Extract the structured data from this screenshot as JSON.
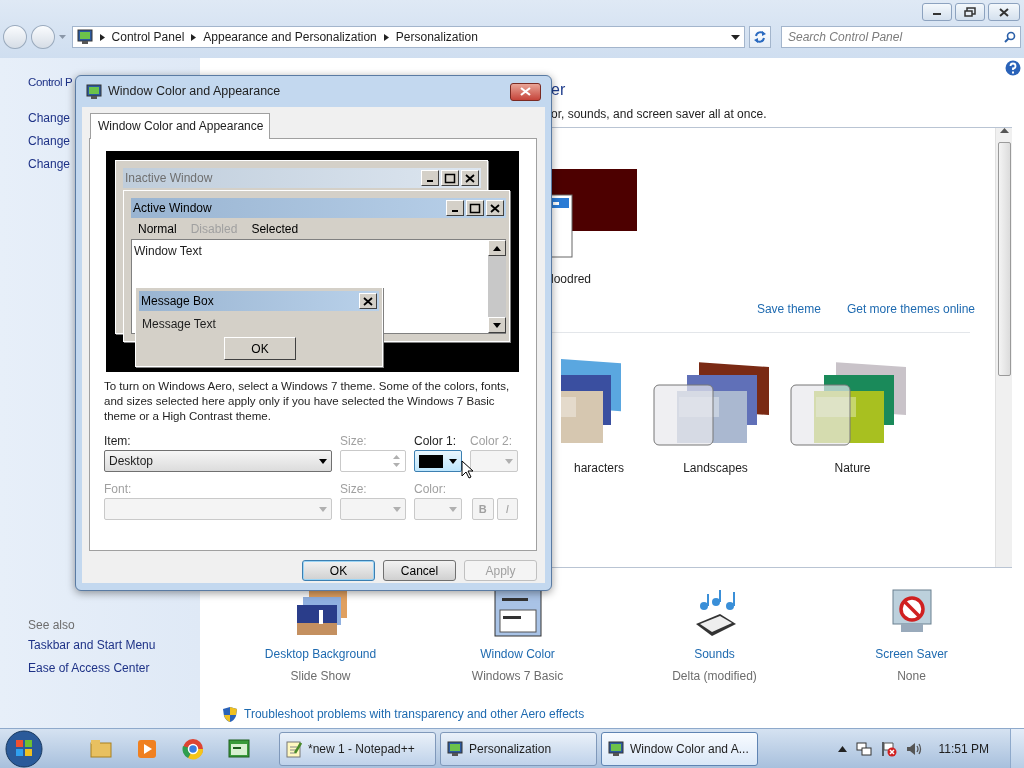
{
  "explorer": {
    "breadcrumb": [
      "Control Panel",
      "Appearance and Personalization",
      "Personalization"
    ],
    "search": {
      "placeholder": "Search Control Panel"
    }
  },
  "sidebar": {
    "items": [
      "Control P",
      "Change",
      "Change",
      "Change"
    ],
    "see_also": {
      "heading": "See also",
      "links": [
        "Taskbar and Start Menu",
        "Ease of Access Center"
      ]
    }
  },
  "main": {
    "heading": "er",
    "description": "or, sounds, and screen saver all at once.",
    "current_theme": {
      "label": "loodred"
    },
    "links": [
      "Save theme",
      "Get more themes online"
    ],
    "themes": [
      {
        "label": "haracters"
      },
      {
        "label": "Landscapes"
      },
      {
        "label": "Nature"
      }
    ],
    "settings": [
      {
        "kind": "background",
        "title": "Desktop Background",
        "value": "Slide Show"
      },
      {
        "kind": "window",
        "title": "Window Color",
        "value": "Windows 7 Basic"
      },
      {
        "kind": "sounds",
        "title": "Sounds",
        "value": "Delta (modified)"
      },
      {
        "kind": "saver",
        "title": "Screen Saver",
        "value": "None"
      }
    ],
    "troubleshoot": "Troubleshoot problems with transparency and other Aero effects"
  },
  "dialog": {
    "title": "Window Color and Appearance",
    "tabs": [
      {
        "label": "Window Color and Appearance",
        "selected": true
      }
    ],
    "preview": {
      "inactive_title": "Inactive Window",
      "active_title": "Active Window",
      "menu": [
        {
          "label": "Normal",
          "disabled": false
        },
        {
          "label": "Disabled",
          "disabled": true
        },
        {
          "label": "Selected",
          "disabled": false
        }
      ],
      "window_text": "Window Text",
      "message_box_title": "Message Box",
      "message_text": "Message Text",
      "ok": "OK"
    },
    "note": "To turn on Windows Aero, select a Windows 7 theme.  Some of the colors, fonts, and sizes selected here apply only if you have selected the Windows 7 Basic theme or a High Contrast theme.",
    "rows": [
      [
        {
          "kind": "select",
          "label": "Item:",
          "value": "Desktop",
          "disabled": false
        },
        {
          "kind": "spin",
          "label": "Size:",
          "disabled": true
        },
        {
          "kind": "color",
          "label": "Color 1:",
          "disabled": false
        },
        {
          "kind": "color",
          "label": "Color 2:",
          "disabled": true
        }
      ],
      [
        {
          "kind": "select",
          "label": "Font:",
          "disabled": true
        },
        {
          "kind": "select",
          "label": "Size:",
          "disabled": true
        },
        {
          "kind": "color",
          "label": "Color:",
          "disabled": true
        },
        {
          "kind": "toggles",
          "items": [
            {
              "label": "B",
              "disabled": true
            },
            {
              "label": "I",
              "disabled": true
            }
          ]
        }
      ]
    ],
    "buttons": [
      {
        "label": "OK",
        "default": true,
        "disabled": false
      },
      {
        "label": "Cancel",
        "default": false,
        "disabled": false
      },
      {
        "label": "Apply",
        "default": false,
        "disabled": true
      }
    ]
  },
  "taskbar": {
    "tasks": [
      {
        "kind": "notepad",
        "label": "*new 1 - Notepad++",
        "selected": false
      },
      {
        "kind": "control",
        "label": "Personalization",
        "selected": false
      },
      {
        "kind": "control",
        "label": "Window Color and A...",
        "selected": true
      }
    ],
    "clock": "11:51 PM"
  }
}
